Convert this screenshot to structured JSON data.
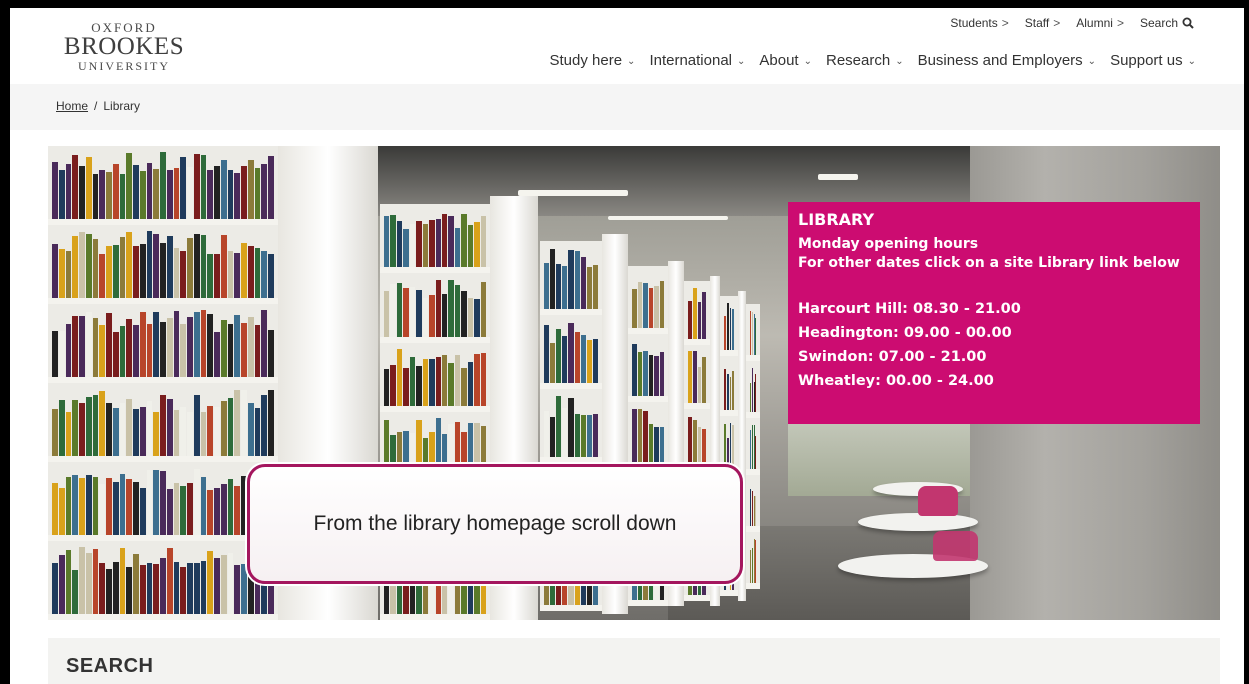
{
  "logo": {
    "line1": "OXFORD",
    "line2": "BROOKES",
    "line3": "UNIVERSITY"
  },
  "utility_nav": [
    {
      "label": "Students",
      "sep": ">"
    },
    {
      "label": "Staff",
      "sep": ">"
    },
    {
      "label": "Alumni",
      "sep": ">"
    },
    {
      "label": "Search",
      "icon": "search-icon"
    }
  ],
  "main_nav": [
    {
      "label": "Study here"
    },
    {
      "label": "International"
    },
    {
      "label": "About"
    },
    {
      "label": "Research"
    },
    {
      "label": "Business and Employers"
    },
    {
      "label": "Support us"
    }
  ],
  "breadcrumb": {
    "home": "Home",
    "separator": "/",
    "current": "Library"
  },
  "infobox": {
    "title": "LIBRARY",
    "subtitle": "Monday opening hours",
    "note": "For other dates click on a site Library link below",
    "hours": [
      "Harcourt Hill: 08.30 - 21.00",
      "Headington: 09.00 - 00.00",
      "Swindon: 07.00 - 21.00",
      "Wheatley: 00.00 - 24.00"
    ]
  },
  "callout": {
    "text": "From the library homepage scroll down"
  },
  "search_section": {
    "title": "SEARCH"
  },
  "colors": {
    "brand_pink": "#cc0c71",
    "callout_border": "#a4165e"
  }
}
